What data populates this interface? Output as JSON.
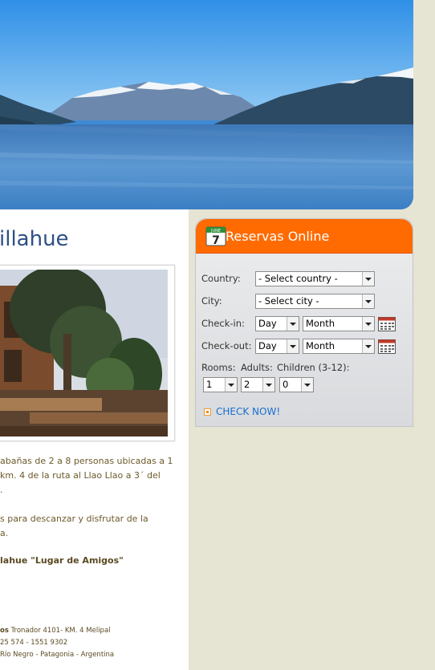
{
  "main": {
    "title": "illahue",
    "paragraph1": [
      "abañas de 2 a 8 personas ubicadas a 1",
      "km. 4 de la ruta al Llao Llao a 3´ del",
      "."
    ],
    "paragraph2": [
      "s para descanzar y disfrutar de la",
      "a."
    ],
    "slogan": "lahue \"Lugar de Amigos\"",
    "footer": {
      "line1_bold": "os",
      "line1_rest": " Tronador 4101- KM. 4 Melipal",
      "line2": "25 574 - 1551 9302",
      "line3": "Río Negro - Patagonia - Argentina"
    }
  },
  "reservation": {
    "title": "Reservas Online",
    "calendar_icon_text": {
      "month": "JUNE",
      "day": "7"
    },
    "country_label": "Country:",
    "country_value": "- Select country -",
    "city_label": "City:",
    "city_value": "- Select city -",
    "checkin_label": "Check-in:",
    "checkout_label": "Check-out:",
    "day_value": "Day",
    "month_value": "Month",
    "rooms_label": "Rooms:",
    "adults_label": "Adults:",
    "children_label": "Children (3-12):",
    "rooms_value": "1",
    "adults_value": "2",
    "children_value": "0",
    "check_now": "CHECK NOW!"
  },
  "colors": {
    "widget_header": "#ff6b00",
    "title_blue": "#2e4f87",
    "link_blue": "#1a6fd1",
    "text_brown": "#6b5a2a",
    "page_bg": "#e6e4d3"
  },
  "icons": [
    "calendar-icon",
    "calendar-picker-icon",
    "dropdown-arrow-icon",
    "bullet-icon"
  ]
}
